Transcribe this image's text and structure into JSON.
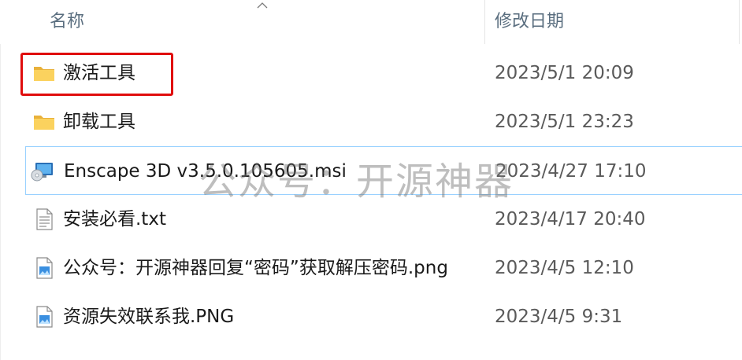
{
  "header": {
    "name_label": "名称",
    "date_label": "修改日期",
    "sort_icon": "chevron-up-icon"
  },
  "files": [
    {
      "name": "激活工具",
      "date": "2023/5/1 20:09",
      "icon": "folder-icon",
      "type": "folder"
    },
    {
      "name": "卸载工具",
      "date": "2023/5/1 23:23",
      "icon": "folder-icon",
      "type": "folder"
    },
    {
      "name": "Enscape 3D v3.5.0.105605.msi",
      "date": "2023/4/27 17:10",
      "icon": "installer-icon",
      "type": "msi"
    },
    {
      "name": "安装必看.txt",
      "date": "2023/4/17 20:40",
      "icon": "text-file-icon",
      "type": "txt"
    },
    {
      "name": "公众号：开源神器回复“密码”获取解压密码.png",
      "date": "2023/4/5 12:10",
      "icon": "image-file-icon",
      "type": "png"
    },
    {
      "name": "资源失效联系我.PNG",
      "date": "2023/4/5 9:31",
      "icon": "image-file-icon",
      "type": "png"
    }
  ],
  "watermark": "公众号：开源神器",
  "colors": {
    "highlight": "#e00d0d",
    "folder": "#f8c94a",
    "selection_border": "#99d1ff"
  }
}
